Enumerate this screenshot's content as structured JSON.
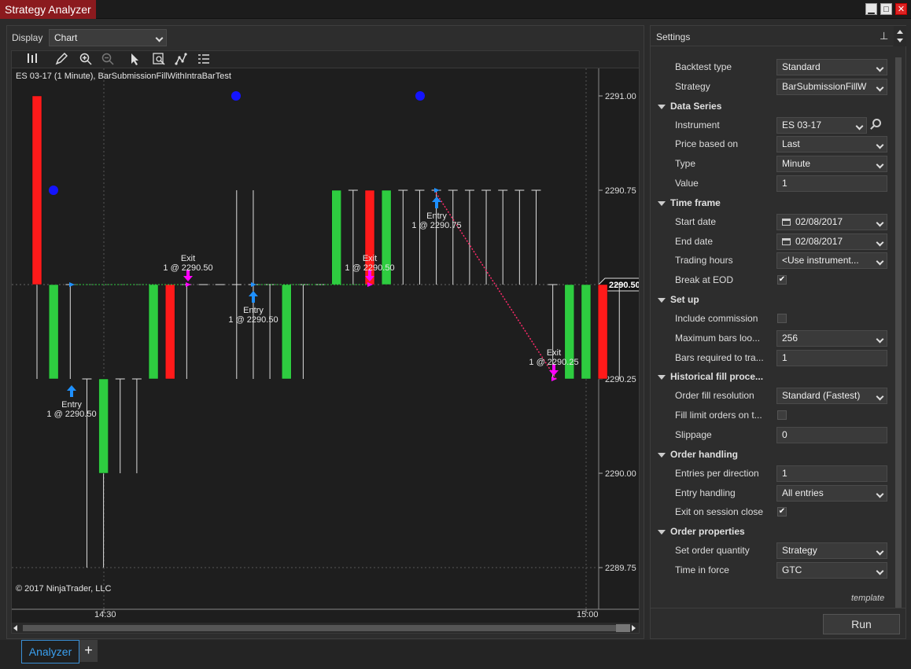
{
  "window": {
    "title": "Strategy Analyzer"
  },
  "display": {
    "label": "Display",
    "value": "Chart"
  },
  "chart": {
    "header": "ES 03-17 (1 Minute), BarSubmissionFillWithIntraBarTest",
    "copyright": "© 2017 NinjaTrader, LLC",
    "price_labels": [
      "2291.00",
      "2290.75",
      "2290.50",
      "2290.25",
      "2290.00",
      "2289.75"
    ],
    "current_price": "2290.50",
    "time_labels": [
      "14:30",
      "15:00"
    ],
    "markers": [
      {
        "kind": "Entry",
        "detail": "1 @ 2290.50"
      },
      {
        "kind": "Exit",
        "detail": "1 @ 2290.50"
      },
      {
        "kind": "Entry",
        "detail": "1 @ 2290.50"
      },
      {
        "kind": "Exit",
        "detail": "1 @ 2290.50"
      },
      {
        "kind": "Entry",
        "detail": "1 @ 2290.75"
      },
      {
        "kind": "Exit",
        "detail": "1 @ 2290.25"
      }
    ],
    "colors": {
      "up": "#2ecc40",
      "down": "#ff1a1a",
      "entry": "#1e90ff",
      "exit": "#ff00ff",
      "dot": "#1414ff"
    },
    "bars": [
      {
        "o": 2290.5,
        "h": 2291.0,
        "l": 2290.25,
        "c": 2291.0,
        "dir": "down"
      },
      {
        "o": 2290.25,
        "h": 2290.5,
        "l": 2290.25,
        "c": 2290.5,
        "dir": "up"
      },
      {
        "o": 2290.5,
        "h": 2290.5,
        "l": 2290.25,
        "c": 2290.5,
        "dir": "flat"
      },
      {
        "o": 2290.25,
        "h": 2290.25,
        "l": 2289.75,
        "c": 2290.25,
        "dir": "flat"
      },
      {
        "o": 2290.0,
        "h": 2290.25,
        "l": 2289.75,
        "c": 2290.25,
        "dir": "up"
      },
      {
        "o": 2290.25,
        "h": 2290.25,
        "l": 2290.0,
        "c": 2290.25,
        "dir": "flat"
      },
      {
        "o": 2290.25,
        "h": 2290.25,
        "l": 2290.0,
        "c": 2290.25,
        "dir": "flat"
      },
      {
        "o": 2290.25,
        "h": 2290.5,
        "l": 2290.25,
        "c": 2290.5,
        "dir": "up"
      },
      {
        "o": 2290.25,
        "h": 2290.5,
        "l": 2290.25,
        "c": 2290.5,
        "dir": "down"
      },
      {
        "o": 2290.5,
        "h": 2290.5,
        "l": 2290.25,
        "c": 2290.5,
        "dir": "flat"
      },
      {
        "o": 2290.5,
        "h": 2290.5,
        "l": 2290.5,
        "c": 2290.5,
        "dir": "flat"
      },
      {
        "o": 2290.5,
        "h": 2290.5,
        "l": 2290.5,
        "c": 2290.5,
        "dir": "flat"
      },
      {
        "o": 2290.5,
        "h": 2290.75,
        "l": 2290.25,
        "c": 2290.5,
        "dir": "flat"
      },
      {
        "o": 2290.5,
        "h": 2290.75,
        "l": 2290.25,
        "c": 2290.5,
        "dir": "flat"
      },
      {
        "o": 2290.5,
        "h": 2290.5,
        "l": 2290.25,
        "c": 2290.5,
        "dir": "flat"
      },
      {
        "o": 2290.25,
        "h": 2290.5,
        "l": 2290.25,
        "c": 2290.5,
        "dir": "up"
      },
      {
        "o": 2290.5,
        "h": 2290.5,
        "l": 2290.25,
        "c": 2290.5,
        "dir": "flat"
      },
      {
        "o": 2290.5,
        "h": 2290.5,
        "l": 2290.5,
        "c": 2290.5,
        "dir": "flat"
      },
      {
        "o": 2290.5,
        "h": 2290.75,
        "l": 2290.5,
        "c": 2290.75,
        "dir": "up"
      },
      {
        "o": 2290.75,
        "h": 2290.75,
        "l": 2290.5,
        "c": 2290.75,
        "dir": "flat"
      },
      {
        "o": 2290.5,
        "h": 2290.75,
        "l": 2290.5,
        "c": 2290.75,
        "dir": "down"
      },
      {
        "o": 2290.5,
        "h": 2290.75,
        "l": 2290.5,
        "c": 2290.75,
        "dir": "up"
      },
      {
        "o": 2290.75,
        "h": 2290.75,
        "l": 2290.5,
        "c": 2290.75,
        "dir": "flat"
      },
      {
        "o": 2290.75,
        "h": 2290.75,
        "l": 2290.5,
        "c": 2290.75,
        "dir": "flat"
      },
      {
        "o": 2290.75,
        "h": 2290.75,
        "l": 2290.5,
        "c": 2290.75,
        "dir": "flat"
      },
      {
        "o": 2290.75,
        "h": 2290.75,
        "l": 2290.5,
        "c": 2290.75,
        "dir": "flat"
      },
      {
        "o": 2290.75,
        "h": 2290.75,
        "l": 2290.5,
        "c": 2290.75,
        "dir": "flat"
      },
      {
        "o": 2290.75,
        "h": 2290.75,
        "l": 2290.5,
        "c": 2290.75,
        "dir": "flat"
      },
      {
        "o": 2290.75,
        "h": 2290.75,
        "l": 2290.5,
        "c": 2290.75,
        "dir": "flat"
      },
      {
        "o": 2290.75,
        "h": 2290.75,
        "l": 2290.5,
        "c": 2290.75,
        "dir": "flat"
      },
      {
        "o": 2290.75,
        "h": 2290.75,
        "l": 2290.5,
        "c": 2290.75,
        "dir": "flat"
      },
      {
        "o": 2290.5,
        "h": 2290.5,
        "l": 2290.25,
        "c": 2290.5,
        "dir": "flat"
      },
      {
        "o": 2290.25,
        "h": 2290.5,
        "l": 2290.25,
        "c": 2290.5,
        "dir": "up"
      },
      {
        "o": 2290.25,
        "h": 2290.5,
        "l": 2290.25,
        "c": 2290.5,
        "dir": "up"
      },
      {
        "o": 2290.25,
        "h": 2290.5,
        "l": 2290.25,
        "c": 2290.5,
        "dir": "down"
      },
      {
        "o": 2290.5,
        "h": 2290.5,
        "l": 2290.25,
        "c": 2290.5,
        "dir": "flat"
      }
    ]
  },
  "toolbar_icons": [
    "bar-chart-icon",
    "pencil-icon",
    "zoom-in-icon",
    "zoom-out-icon",
    "pointer-icon",
    "data-box-icon",
    "draw-tools-icon",
    "properties-icon"
  ],
  "settings": {
    "title": "Settings",
    "template": "template",
    "run": "Run",
    "rows": [
      {
        "type": "field",
        "label": "Backtest type",
        "value": "Standard",
        "control": "select"
      },
      {
        "type": "field",
        "label": "Strategy",
        "value": "BarSubmissionFillW",
        "control": "select"
      },
      {
        "type": "cat",
        "label": "Data Series"
      },
      {
        "type": "field",
        "label": "Instrument",
        "value": "ES 03-17",
        "control": "instrument"
      },
      {
        "type": "field",
        "label": "Price based on",
        "value": "Last",
        "control": "select"
      },
      {
        "type": "field",
        "label": "Type",
        "value": "Minute",
        "control": "select"
      },
      {
        "type": "field",
        "label": "Value",
        "value": "1",
        "control": "text"
      },
      {
        "type": "cat",
        "label": "Time frame"
      },
      {
        "type": "field",
        "label": "Start date",
        "value": "02/08/2017",
        "control": "date"
      },
      {
        "type": "field",
        "label": "End date",
        "value": "02/08/2017",
        "control": "date"
      },
      {
        "type": "field",
        "label": "Trading hours",
        "value": "<Use instrument...",
        "control": "select"
      },
      {
        "type": "field",
        "label": "Break at EOD",
        "value": "✔",
        "control": "check"
      },
      {
        "type": "cat",
        "label": "Set up"
      },
      {
        "type": "field",
        "label": "Include commission",
        "value": "",
        "control": "check"
      },
      {
        "type": "field",
        "label": "Maximum bars loo...",
        "value": "256",
        "control": "select"
      },
      {
        "type": "field",
        "label": "Bars required to tra...",
        "value": "1",
        "control": "text"
      },
      {
        "type": "cat",
        "label": "Historical fill proce..."
      },
      {
        "type": "field",
        "label": "Order fill resolution",
        "value": "Standard (Fastest)",
        "control": "select"
      },
      {
        "type": "field",
        "label": "Fill limit orders on t...",
        "value": "",
        "control": "check"
      },
      {
        "type": "field",
        "label": "Slippage",
        "value": "0",
        "control": "text"
      },
      {
        "type": "cat",
        "label": "Order handling"
      },
      {
        "type": "field",
        "label": "Entries per direction",
        "value": "1",
        "control": "text"
      },
      {
        "type": "field",
        "label": "Entry handling",
        "value": "All entries",
        "control": "select"
      },
      {
        "type": "field",
        "label": "Exit on session close",
        "value": "✔",
        "control": "check"
      },
      {
        "type": "cat",
        "label": "Order properties"
      },
      {
        "type": "field",
        "label": "Set order quantity",
        "value": "Strategy",
        "control": "select"
      },
      {
        "type": "field",
        "label": "Time in force",
        "value": "GTC",
        "control": "select"
      }
    ]
  },
  "tabs": {
    "active": "Analyzer",
    "add": "+"
  },
  "buttons": {
    "minimize": "▁",
    "maximize": "□",
    "close": "✕"
  }
}
